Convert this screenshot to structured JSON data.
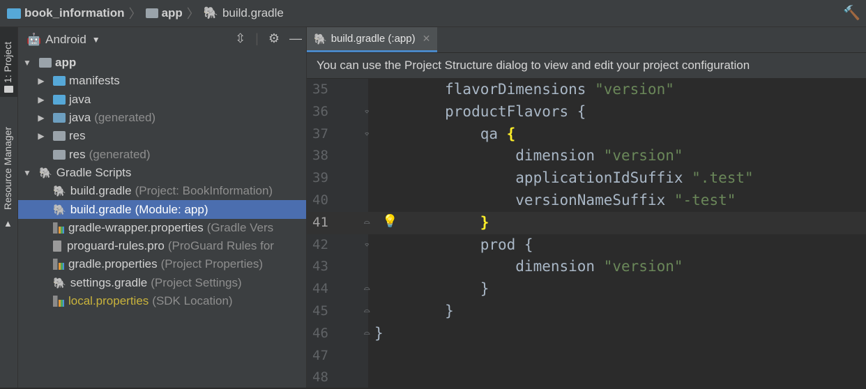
{
  "breadcrumb": {
    "items": [
      "book_information",
      "app",
      "build.gradle"
    ]
  },
  "strip": {
    "project_tab": "1: Project",
    "resource_tab": "Resource Manager"
  },
  "project_panel": {
    "view_label": "Android",
    "tree": [
      {
        "label": "app",
        "sub": "",
        "depth": 0,
        "arrow": "expanded",
        "icon": "module-folder-icon"
      },
      {
        "label": "manifests",
        "sub": "",
        "depth": 1,
        "arrow": "collapsed",
        "icon": "folder-icon"
      },
      {
        "label": "java",
        "sub": "",
        "depth": 1,
        "arrow": "collapsed",
        "icon": "folder-icon"
      },
      {
        "label": "java",
        "sub": "(generated)",
        "depth": 1,
        "arrow": "collapsed",
        "icon": "generated-folder-icon"
      },
      {
        "label": "res",
        "sub": "",
        "depth": 1,
        "arrow": "collapsed",
        "icon": "res-folder-icon"
      },
      {
        "label": "res",
        "sub": "(generated)",
        "depth": 1,
        "arrow": "none",
        "icon": "res-folder-icon"
      },
      {
        "label": "Gradle Scripts",
        "sub": "",
        "depth": 0,
        "arrow": "expanded",
        "icon": "gradle-icon"
      },
      {
        "label": "build.gradle",
        "sub": "(Project: BookInformation)",
        "depth": 1,
        "arrow": "none",
        "icon": "gradle-icon"
      },
      {
        "label": "build.gradle",
        "sub": "(Module: app)",
        "depth": 1,
        "arrow": "none",
        "icon": "gradle-icon",
        "selected": true
      },
      {
        "label": "gradle-wrapper.properties",
        "sub": "(Gradle Vers",
        "depth": 1,
        "arrow": "none",
        "icon": "properties-icon"
      },
      {
        "label": "proguard-rules.pro",
        "sub": "(ProGuard Rules for",
        "depth": 1,
        "arrow": "none",
        "icon": "file-icon"
      },
      {
        "label": "gradle.properties",
        "sub": "(Project Properties)",
        "depth": 1,
        "arrow": "none",
        "icon": "properties-icon"
      },
      {
        "label": "settings.gradle",
        "sub": "(Project Settings)",
        "depth": 1,
        "arrow": "none",
        "icon": "gradle-icon"
      },
      {
        "label": "local.properties",
        "sub": "(SDK Location)",
        "depth": 1,
        "arrow": "none",
        "icon": "properties-icon",
        "local": true
      }
    ]
  },
  "editor": {
    "tab_label": "build.gradle (:app)",
    "notice": "You can use the Project Structure dialog to view and edit your project configuration",
    "current_line": "41",
    "lines": [
      {
        "n": "35",
        "parts": [
          {
            "t": "        flavorDimensions "
          },
          {
            "t": "\"version\"",
            "s": "str"
          }
        ]
      },
      {
        "n": "36",
        "parts": [
          {
            "t": "        productFlavors {"
          }
        ],
        "fold": "open"
      },
      {
        "n": "37",
        "parts": [
          {
            "t": "            qa "
          },
          {
            "t": "{",
            "s": "brace"
          }
        ],
        "fold": "open"
      },
      {
        "n": "38",
        "parts": [
          {
            "t": "                dimension "
          },
          {
            "t": "\"version\"",
            "s": "str"
          }
        ]
      },
      {
        "n": "39",
        "parts": [
          {
            "t": "                applicationIdSuffix "
          },
          {
            "t": "\".test\"",
            "s": "str"
          }
        ]
      },
      {
        "n": "40",
        "parts": [
          {
            "t": "                versionNameSuffix "
          },
          {
            "t": "\"-test\"",
            "s": "str"
          }
        ]
      },
      {
        "n": "41",
        "parts": [
          {
            "t": "            "
          },
          {
            "t": "}",
            "s": "brace"
          }
        ],
        "fold": "close",
        "bulb": true
      },
      {
        "n": "42",
        "parts": [
          {
            "t": "            prod {"
          }
        ],
        "fold": "open"
      },
      {
        "n": "43",
        "parts": [
          {
            "t": "                dimension "
          },
          {
            "t": "\"version\"",
            "s": "str"
          }
        ]
      },
      {
        "n": "44",
        "parts": [
          {
            "t": "            }"
          }
        ],
        "fold": "close"
      },
      {
        "n": "45",
        "parts": [
          {
            "t": "        }"
          }
        ],
        "fold": "close"
      },
      {
        "n": "46",
        "parts": [
          {
            "t": "}"
          }
        ],
        "fold": "close"
      },
      {
        "n": "47",
        "parts": [
          {
            "t": ""
          }
        ]
      },
      {
        "n": "48",
        "parts": [
          {
            "t": ""
          }
        ]
      }
    ]
  }
}
